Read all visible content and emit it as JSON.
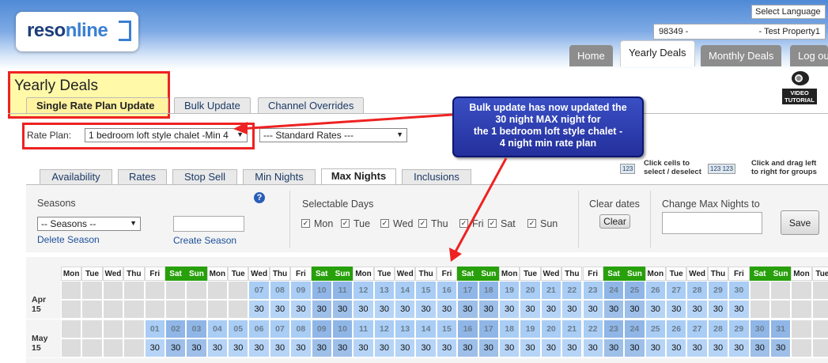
{
  "header": {
    "logo_text_a": "reso",
    "logo_text_b": "nline",
    "select_language": "Select Language",
    "property_id": "98349 -",
    "property_name": "- Test Property1",
    "nav_tabs": [
      {
        "label": "Home",
        "active": false
      },
      {
        "label": "Yearly Deals",
        "active": true
      },
      {
        "label": "Monthly Deals",
        "active": false
      },
      {
        "label": "Log ou",
        "active": false
      }
    ],
    "video_tutorial": "VIDEO TUTORIAL"
  },
  "page": {
    "title": "Yearly Deals",
    "subtabs": [
      {
        "label": "Single Rate Plan Update",
        "active": true
      },
      {
        "label": "Bulk Update",
        "active": false
      },
      {
        "label": "Channel Overrides",
        "active": false
      }
    ]
  },
  "rate_plan": {
    "label": "Rate Plan:",
    "selected": "1 bedroom loft style chalet -Min 4",
    "second_selected": "--- Standard Rates ---"
  },
  "callout": {
    "line1": "Bulk update has now updated the",
    "line2": "30 night MAX night for",
    "line3": "the 1 bedroom loft style chalet -",
    "line4": "4 night min rate plan"
  },
  "hints": {
    "click_line1": "Click cells to",
    "click_line2": "select / deselect",
    "drag_line1": "Click and drag left",
    "drag_line2": "to right for groups",
    "icon_click": "123",
    "icon_drag": "123 123"
  },
  "inner_tabs": [
    {
      "label": "Availability",
      "active": false
    },
    {
      "label": "Rates",
      "active": false
    },
    {
      "label": "Stop Sell",
      "active": false
    },
    {
      "label": "Min Nights",
      "active": false
    },
    {
      "label": "Max Nights",
      "active": true
    },
    {
      "label": "Inclusions",
      "active": false
    }
  ],
  "panel": {
    "seasons_label": "Seasons",
    "seasons_select": "-- Seasons --",
    "delete_season": "Delete Season",
    "create_season": "Create Season",
    "selectable_days_label": "Selectable Days",
    "days": [
      {
        "label": "Mon",
        "checked": true
      },
      {
        "label": "Tue",
        "checked": true
      },
      {
        "label": "Wed",
        "checked": true
      },
      {
        "label": "Thu",
        "checked": true
      },
      {
        "label": "Fri",
        "checked": true
      },
      {
        "label": "Sat",
        "checked": true
      },
      {
        "label": "Sun",
        "checked": true
      }
    ],
    "clear_dates_label": "Clear dates",
    "clear_button": "Clear",
    "change_max_label": "Change Max Nights to",
    "save_button": "Save"
  },
  "calendar": {
    "day_headers": [
      "Mon",
      "Tue",
      "Wed",
      "Thu",
      "Fri",
      "Sat",
      "Sun",
      "Mon",
      "Tue",
      "Wed",
      "Thu",
      "Fri",
      "Sat",
      "Sun",
      "Mon",
      "Tue",
      "Wed",
      "Thu",
      "Fri",
      "Sat",
      "Sun",
      "Mon",
      "Tue",
      "Wed",
      "Thu",
      "Fri",
      "Sat",
      "Sun",
      "Mon",
      "Tue",
      "Wed",
      "Thu",
      "Fri",
      "Sat",
      "Sun",
      "Mon",
      "Tue"
    ],
    "weekend_color": "#28a00c",
    "months": [
      {
        "label": "Apr 15",
        "dates": [
          "",
          "",
          "",
          "",
          "",
          "",
          "",
          "",
          "",
          "07",
          "08",
          "09",
          "10",
          "11",
          "12",
          "13",
          "14",
          "15",
          "16",
          "17",
          "18",
          "19",
          "20",
          "21",
          "22",
          "23",
          "24",
          "25",
          "26",
          "27",
          "28",
          "29",
          "30",
          "",
          "",
          "",
          ""
        ],
        "values": [
          "",
          "",
          "",
          "",
          "",
          "",
          "",
          "",
          "",
          "30",
          "30",
          "30",
          "30",
          "30",
          "30",
          "30",
          "30",
          "30",
          "30",
          "30",
          "30",
          "30",
          "30",
          "30",
          "30",
          "30",
          "30",
          "30",
          "30",
          "30",
          "30",
          "30",
          "30",
          "",
          "",
          "",
          ""
        ]
      },
      {
        "label": "May 15",
        "dates": [
          "",
          "",
          "",
          "",
          "01",
          "02",
          "03",
          "04",
          "05",
          "06",
          "07",
          "08",
          "09",
          "10",
          "11",
          "12",
          "13",
          "14",
          "15",
          "16",
          "17",
          "18",
          "19",
          "20",
          "21",
          "22",
          "23",
          "24",
          "25",
          "26",
          "27",
          "28",
          "29",
          "30",
          "31",
          "",
          ""
        ],
        "values": [
          "",
          "",
          "",
          "",
          "30",
          "30",
          "30",
          "30",
          "30",
          "30",
          "30",
          "30",
          "30",
          "30",
          "30",
          "30",
          "30",
          "30",
          "30",
          "30",
          "30",
          "30",
          "30",
          "30",
          "30",
          "30",
          "30",
          "30",
          "30",
          "30",
          "30",
          "30",
          "30",
          "30",
          "30",
          "",
          ""
        ]
      }
    ]
  }
}
